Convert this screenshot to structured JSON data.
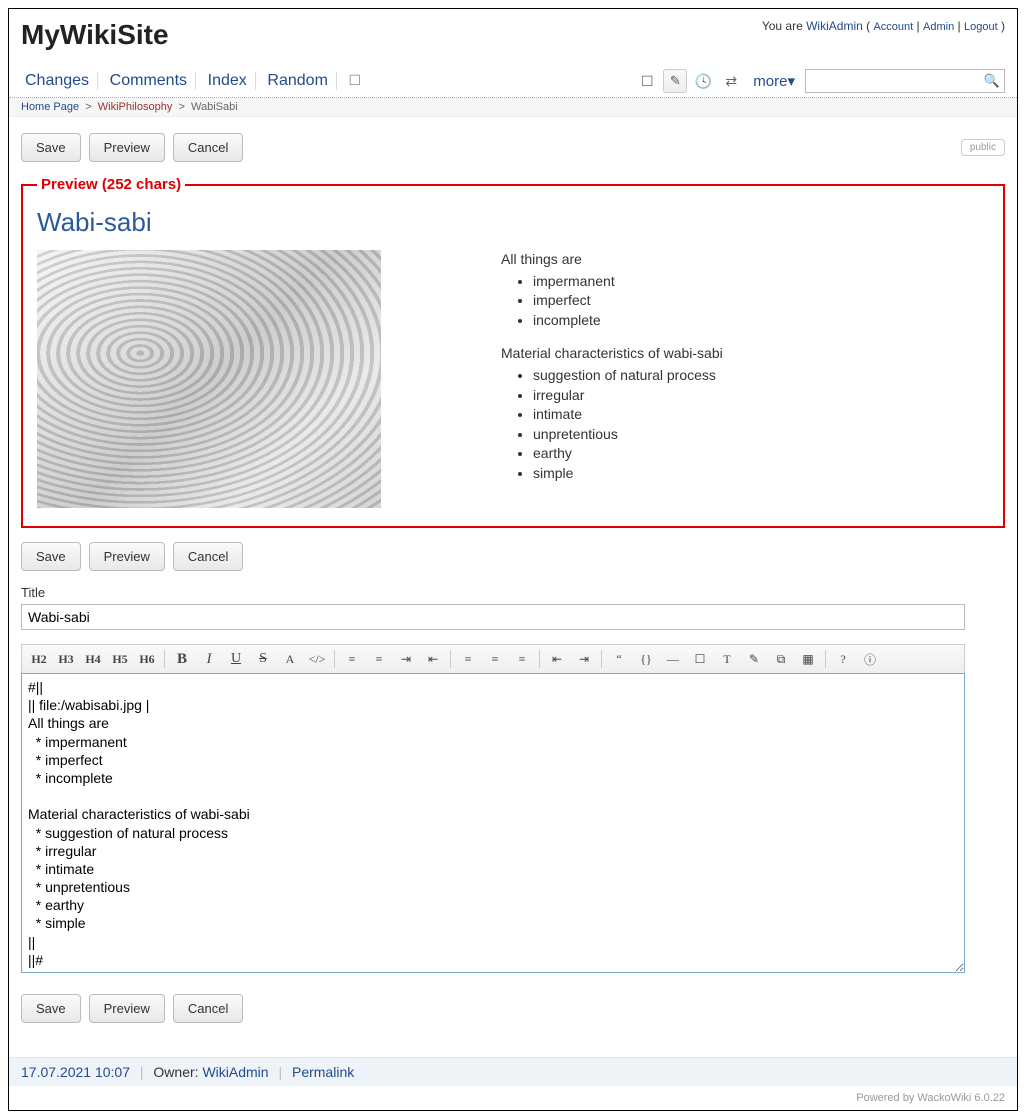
{
  "site_title": "MyWikiSite",
  "user": {
    "prefix": "You are",
    "name": "WikiAdmin",
    "account": "Account",
    "admin": "Admin",
    "logout": "Logout"
  },
  "nav": {
    "changes": "Changes",
    "comments": "Comments",
    "index": "Index",
    "random": "Random",
    "more": "more▾"
  },
  "breadcrumb": {
    "home": "Home Page",
    "cat": "WikiPhilosophy",
    "page": "WabiSabi"
  },
  "buttons": {
    "save": "Save",
    "preview": "Preview",
    "cancel": "Cancel",
    "public": "public"
  },
  "preview": {
    "legend": "Preview (252 chars)",
    "heading": "Wabi-sabi",
    "p1": "All things are",
    "list1": [
      "impermanent",
      "imperfect",
      "incomplete"
    ],
    "p2": "Material characteristics of wabi-sabi",
    "list2": [
      "suggestion of natural process",
      "irregular",
      "intimate",
      "unpretentious",
      "earthy",
      "simple"
    ]
  },
  "title_label": "Title",
  "title_value": "Wabi-sabi",
  "toolbar": {
    "h2": "H2",
    "h3": "H3",
    "h4": "H4",
    "h5": "H5",
    "h6": "H6",
    "bold": "B",
    "italic": "I",
    "underline": "U",
    "strike": "S",
    "font": "A",
    "code": "</>",
    "ol": "≡",
    "ul": "≡",
    "indentr": "⇥",
    "indentl": "⇤",
    "al": "≡",
    "ac": "≡",
    "ar": "≡",
    "outdent": "⇤",
    "indent": "⇥",
    "quote": "“",
    "brace": "{}",
    "hr": "—",
    "note": "☐",
    "sup": "T",
    "hl": "✎",
    "link": "⧉",
    "table": "▦",
    "help": "?",
    "info": "ⓘ"
  },
  "editor_content": "#||\n|| file:/wabisabi.jpg |\nAll things are\n  * impermanent\n  * imperfect\n  * incomplete\n\nMaterial characteristics of wabi-sabi\n  * suggestion of natural process\n  * irregular\n  * intimate\n  * unpretentious\n  * earthy\n  * simple\n||\n||#",
  "footer": {
    "date": "17.07.2021 10:07",
    "owner_label": "Owner:",
    "owner": "WikiAdmin",
    "permalink": "Permalink"
  },
  "powered": "Powered by WackoWiki 6.0.22"
}
